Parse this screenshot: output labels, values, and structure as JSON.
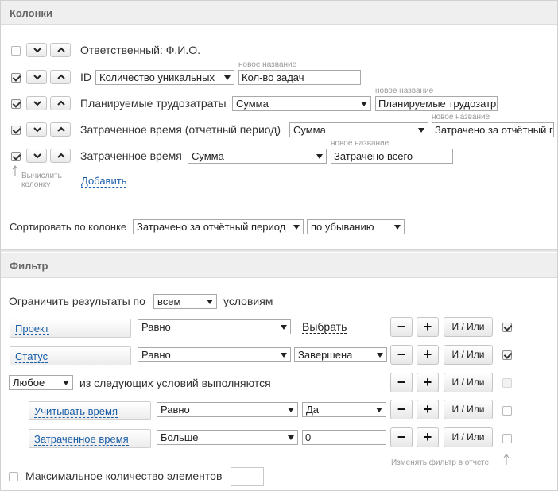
{
  "columns_section": {
    "title": "Колонки",
    "rows": [
      {
        "checked": false,
        "name": "Ответственный: Ф.И.О.",
        "function": "",
        "new_name": ""
      },
      {
        "checked": true,
        "name": "ID",
        "function": "Количество уникальных",
        "new_name": "Кол-во задач",
        "hint": "новое название"
      },
      {
        "checked": true,
        "name": "Планируемые трудозатраты",
        "function": "Сумма",
        "new_name": "Планируемые трудозатр",
        "hint": "новое название"
      },
      {
        "checked": true,
        "name": "Затраченное время (отчетный период)",
        "function": "Сумма",
        "new_name": "Затрачено за отчётный г",
        "hint": "новое название"
      },
      {
        "checked": true,
        "name": "Затраченное время",
        "function": "Сумма",
        "new_name": "Затрачено всего",
        "hint": "новое название"
      }
    ],
    "calc_hint_line1": "Вычислить",
    "calc_hint_line2": "колонку",
    "add_link": "Добавить",
    "sort_label": "Сортировать по колонке",
    "sort_column": "Затрачено за отчётный период",
    "sort_order": "по убыванию"
  },
  "filter_section": {
    "title": "Фильтр",
    "limit_label": "Ограничить результаты по",
    "limit_value": "всем",
    "limit_suffix": "условиям",
    "conditions": [
      {
        "field": "Проект",
        "operator": "Равно",
        "value": "Выбрать",
        "checked": true
      },
      {
        "field": "Статус",
        "operator": "Равно",
        "value": "Завершена",
        "checked": true
      }
    ],
    "group": {
      "mode": "Любое",
      "label": "из следующих условий выполняются",
      "checked": false
    },
    "sub_conditions": [
      {
        "field": "Учитывать время",
        "operator": "Равно",
        "value": "Да",
        "checked": false
      },
      {
        "field": "Затраченное время",
        "operator": "Больше",
        "value": "0",
        "checked": false
      }
    ],
    "minus_label": "−",
    "plus_label": "+",
    "logic_label": "И / Или",
    "report_hint": "Изменять фильтр в отчете",
    "max_items_label": "Максимальное количество элементов",
    "max_items_value": ""
  }
}
